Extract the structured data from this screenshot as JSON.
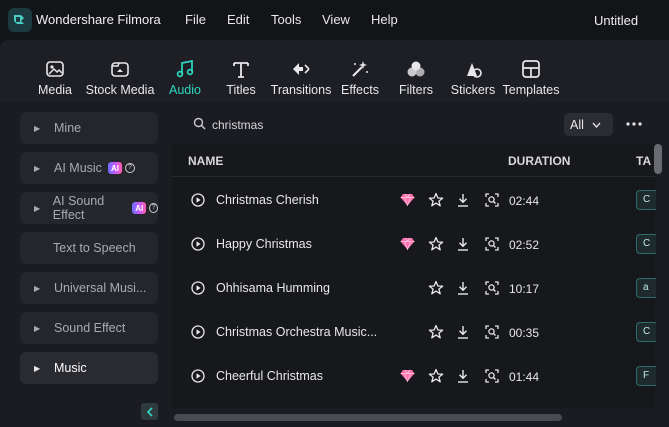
{
  "app": {
    "name": "Wondershare Filmora",
    "document_title": "Untitled"
  },
  "menu": [
    "File",
    "Edit",
    "Tools",
    "View",
    "Help"
  ],
  "toolbar": {
    "active": "Audio",
    "accent_color": "#2fd8c2",
    "tools": [
      {
        "label": "Media",
        "icon": "media-icon"
      },
      {
        "label": "Stock Media",
        "icon": "stock-media-icon"
      },
      {
        "label": "Audio",
        "icon": "music-note-icon"
      },
      {
        "label": "Titles",
        "icon": "titles-icon"
      },
      {
        "label": "Transitions",
        "icon": "transitions-icon"
      },
      {
        "label": "Effects",
        "icon": "effects-icon"
      },
      {
        "label": "Filters",
        "icon": "filters-icon"
      },
      {
        "label": "Stickers",
        "icon": "stickers-icon"
      },
      {
        "label": "Templates",
        "icon": "templates-icon"
      }
    ]
  },
  "sidebar": {
    "items": [
      {
        "label": "Mine",
        "expandable": true
      },
      {
        "label": "AI Music",
        "expandable": true,
        "badge": "AI"
      },
      {
        "label": "AI Sound Effect",
        "expandable": true,
        "badge": "AI"
      },
      {
        "label": "Text to Speech",
        "expandable": false
      },
      {
        "label": "Universal Musi...",
        "expandable": true
      },
      {
        "label": "Sound Effect",
        "expandable": true
      },
      {
        "label": "Music",
        "expandable": true,
        "active": true
      }
    ]
  },
  "search": {
    "value": "christmas",
    "placeholder": ""
  },
  "filter": {
    "selected": "All"
  },
  "table": {
    "columns": [
      "NAME",
      "DURATION",
      "TA"
    ],
    "rows": [
      {
        "name": "Christmas Cherish",
        "premium": true,
        "duration": "02:44",
        "tag": "C"
      },
      {
        "name": "Happy Christmas",
        "premium": true,
        "duration": "02:52",
        "tag": "C"
      },
      {
        "name": "Ohhisama Humming",
        "premium": false,
        "duration": "10:17",
        "tag": "a"
      },
      {
        "name": "Christmas Orchestra Music...",
        "premium": false,
        "duration": "00:35",
        "tag": "C"
      },
      {
        "name": "Cheerful Christmas",
        "premium": true,
        "duration": "01:44",
        "tag": "F"
      }
    ]
  }
}
